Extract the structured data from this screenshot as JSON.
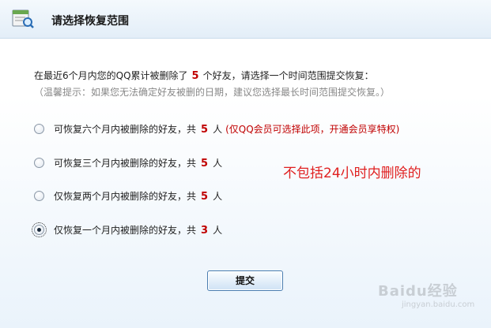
{
  "header": {
    "title": "请选择恢复范围",
    "icon": "calendar-search-icon"
  },
  "intro": {
    "prefix": "在最近6个月内您的QQ累计被删除了",
    "count": "5",
    "suffix": "个好友，请选择一个时间范围提交恢复：",
    "hint": "（温馨提示：如果您无法确定好友被删的日期，建议您选择最长时间范围提交恢复。）"
  },
  "options": [
    {
      "label": "可恢复六个月内被删除的好友，共",
      "count": "5",
      "unit": "人",
      "note": "(仅QQ会员可选择此项，开通会员享特权)",
      "selected": false
    },
    {
      "label": "可恢复三个月内被删除的好友，共",
      "count": "5",
      "unit": "人",
      "note": "",
      "selected": false
    },
    {
      "label": "仅恢复两个月内被删除的好友，共",
      "count": "5",
      "unit": "人",
      "note": "",
      "selected": false
    },
    {
      "label": "仅恢复一个月内被删除的好友，共",
      "count": "3",
      "unit": "人",
      "note": "",
      "selected": true
    }
  ],
  "annotation": "不包括24小时内删除的",
  "submit_label": "提交",
  "watermark": {
    "brand": "Baidu经验",
    "url": "jingyan.baidu.com"
  },
  "colors": {
    "highlight": "#c00000",
    "annotation": "#e02020",
    "header_bg": "#e3eef8"
  }
}
